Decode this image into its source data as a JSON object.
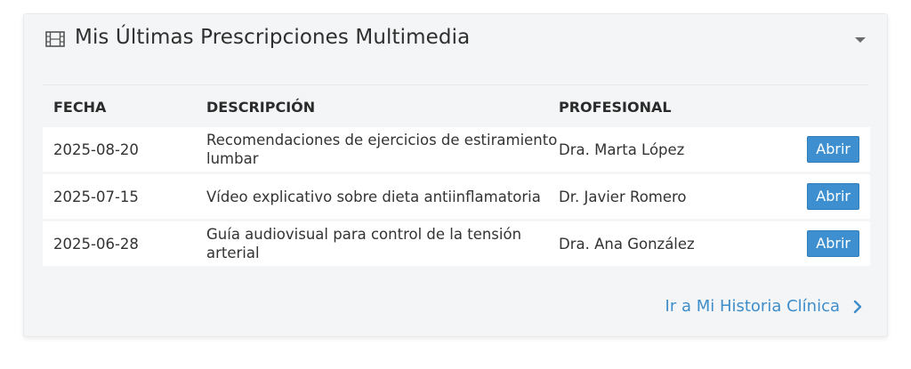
{
  "panel": {
    "title": "Mis Últimas Prescripciones Multimedia",
    "icon": "film-icon",
    "collapse_icon": "caret-down-icon"
  },
  "table": {
    "headers": [
      "FECHA",
      "DESCRIPCIÓN",
      "PROFESIONAL"
    ],
    "rows": [
      {
        "date": "2025-08-20",
        "description": "Recomendaciones de ejercicios de estiramiento lumbar",
        "professional": "Dra. Marta López",
        "action": "Abrir"
      },
      {
        "date": "2025-07-15",
        "description": "Vídeo explicativo sobre dieta antiinflamatoria",
        "professional": "Dr. Javier Romero",
        "action": "Abrir"
      },
      {
        "date": "2025-06-28",
        "description": "Guía audiovisual para control de la tensión arterial",
        "professional": "Dra. Ana González",
        "action": "Abrir"
      }
    ]
  },
  "footer": {
    "link_label": "Ir a Mi Historia Clínica",
    "link_icon": "chevron-right-icon"
  },
  "colors": {
    "accent": "#3d8fcf",
    "panel_bg": "#f4f5f6",
    "row_bg": "#ffffff",
    "text": "#333333"
  }
}
